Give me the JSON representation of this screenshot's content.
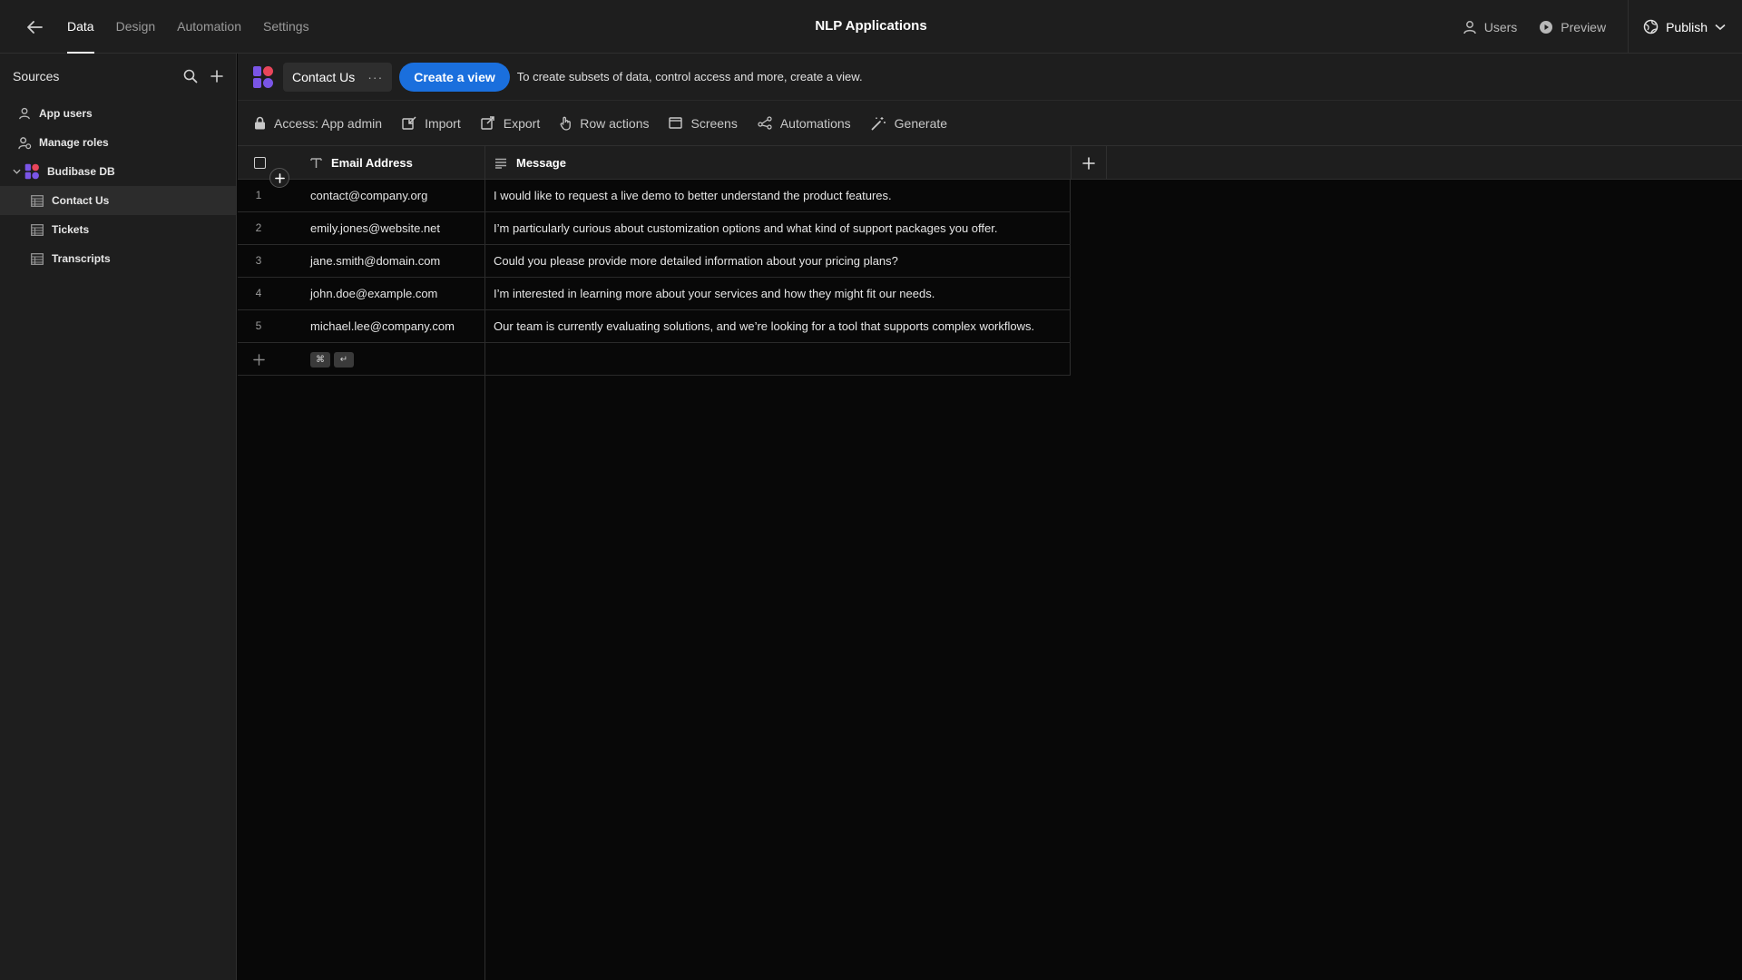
{
  "app": {
    "title": "NLP Applications"
  },
  "nav": {
    "tabs": [
      {
        "label": "Data",
        "active": true
      },
      {
        "label": "Design"
      },
      {
        "label": "Automation"
      },
      {
        "label": "Settings"
      }
    ]
  },
  "top_right": {
    "users": "Users",
    "preview": "Preview",
    "publish": "Publish"
  },
  "sidebar": {
    "title": "Sources",
    "items": [
      {
        "label": "App users",
        "icon": "user-icon"
      },
      {
        "label": "Manage roles",
        "icon": "roles-icon"
      },
      {
        "label": "Budibase DB",
        "icon": "budibase-logo-icon"
      },
      {
        "label": "Contact Us",
        "icon": "table-icon",
        "selected": true
      },
      {
        "label": "Tickets",
        "icon": "table-icon"
      },
      {
        "label": "Transcripts",
        "icon": "table-icon"
      }
    ]
  },
  "header": {
    "table_name": "Contact Us",
    "create_view": "Create a view",
    "hint": "To create subsets of data, control access and more, create a view."
  },
  "toolbar": {
    "access": "Access: App admin",
    "import": "Import",
    "export": "Export",
    "row_actions": "Row actions",
    "screens": "Screens",
    "automations": "Automations",
    "generate": "Generate"
  },
  "table": {
    "columns": [
      "Email Address",
      "Message"
    ],
    "rows": [
      {
        "num": "1",
        "email": "contact@company.org",
        "message": "I would like to request a live demo to better understand the product features."
      },
      {
        "num": "2",
        "email": "emily.jones@website.net",
        "message": "I’m particularly curious about customization options and what kind of support packages you offer."
      },
      {
        "num": "3",
        "email": "jane.smith@domain.com",
        "message": "Could you please provide more detailed information about your pricing plans?"
      },
      {
        "num": "4",
        "email": "john.doe@example.com",
        "message": "I’m interested in learning more about your services and how they might fit our needs."
      },
      {
        "num": "5",
        "email": "michael.lee@company.com",
        "message": "Our team is currently evaluating solutions, and we’re looking for a tool that supports complex workflows."
      }
    ],
    "shortcut_keys": [
      "⌘",
      "↵"
    ]
  },
  "colors": {
    "accent": "#1a6fdd",
    "logo_red": "#e8455a",
    "logo_purple": "#7a55e6"
  }
}
